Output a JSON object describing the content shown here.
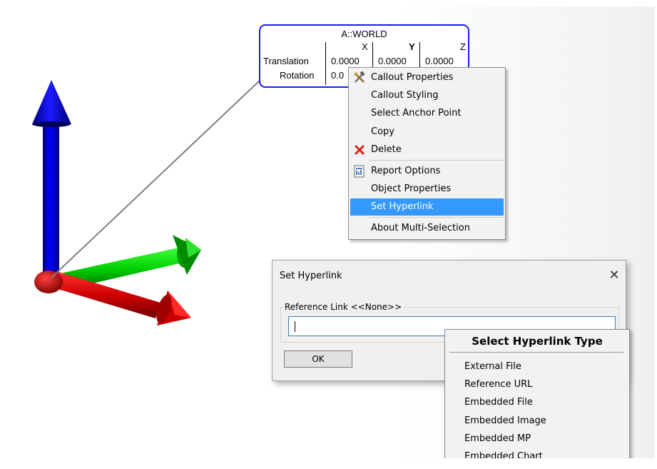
{
  "callout": {
    "title": "A::WORLD",
    "col_x": "X",
    "col_y": "Y",
    "col_z": "Z",
    "row1_label": "Translation",
    "row1_x": "0.0000",
    "row1_y": "0.0000",
    "row1_z": "0.0000",
    "row2_label": "Rotation",
    "row2_x": "0.0"
  },
  "context_menu": {
    "items": [
      {
        "label": "Callout Properties",
        "icon": "tools-icon"
      },
      {
        "label": "Callout Styling"
      },
      {
        "label": "Select Anchor Point"
      },
      {
        "label": "Copy"
      },
      {
        "label": "Delete",
        "icon": "delete-x-icon"
      },
      {
        "label": "Report Options",
        "icon": "report-icon"
      },
      {
        "label": "Object Properties"
      },
      {
        "label": "Set Hyperlink",
        "selected": true
      },
      {
        "label": "About Multi-Selection"
      }
    ]
  },
  "dialog": {
    "title": "Set Hyperlink",
    "close": "✕",
    "group_label": "Reference Link <<None>>",
    "input_value": "",
    "ok_label": "OK"
  },
  "type_menu": {
    "title": "Select Hyperlink Type",
    "items": [
      "External File",
      "Reference URL",
      "Embedded File",
      "Embedded Image",
      "Embedded MP",
      "Embedded Chart"
    ]
  },
  "colors": {
    "axis_z": "#0000ff",
    "axis_y": "#00c800",
    "axis_x": "#dd0000",
    "callout_border": "#1a1aff",
    "menu_highlight": "#3399ff"
  }
}
